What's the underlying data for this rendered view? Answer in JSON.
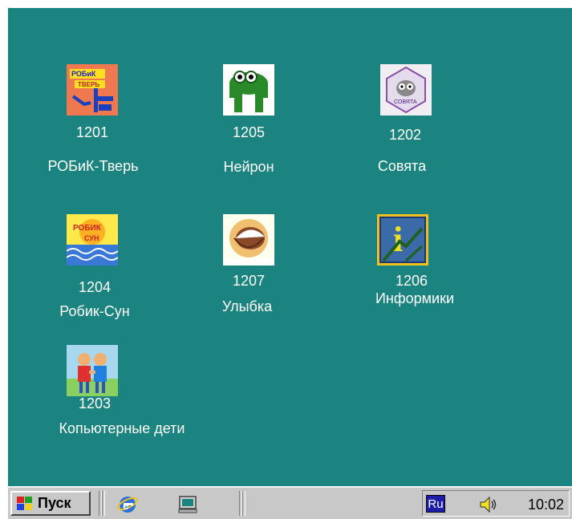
{
  "desktop": {
    "background": "#1c8480",
    "icons": [
      {
        "id": "robik-tver",
        "number": "1201",
        "name": "РОБиК-Тверь",
        "image": "robik-tver-icon",
        "logo_text": [
          "РОБиК",
          "ТВЕРЬ"
        ]
      },
      {
        "id": "neyron",
        "number": "1205",
        "name": "Нейрон",
        "image": "frog-icon"
      },
      {
        "id": "sovyata",
        "number": "1202",
        "name": "Совята",
        "image": "owl-icon",
        "logo_text": [
          "СОВЯТА"
        ]
      },
      {
        "id": "robik-sun",
        "number": "1204",
        "name": "Робик-Сун",
        "image": "robik-sun-icon",
        "logo_text": [
          "РОБИК",
          "СУН"
        ]
      },
      {
        "id": "ulybka",
        "number": "1207",
        "name": "Улыбка",
        "image": "smile-icon"
      },
      {
        "id": "informiki",
        "number": "1206",
        "name": "Информики",
        "image": "info-letter-icon",
        "logo_text": [
          "i"
        ]
      },
      {
        "id": "computer-kids",
        "number": "1203",
        "name": "Копьютерные дети",
        "image": "kids-icon"
      }
    ]
  },
  "taskbar": {
    "start_label": "Пуск",
    "quick_launch": [
      "internet-explorer-icon",
      "show-desktop-icon"
    ],
    "language": "Ru",
    "volume_icon": "speaker-icon",
    "clock": "10:02"
  }
}
